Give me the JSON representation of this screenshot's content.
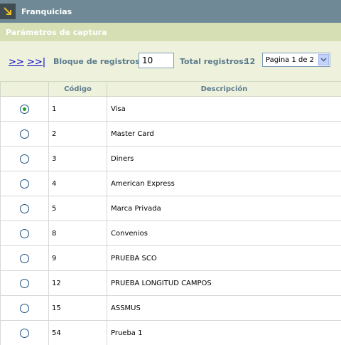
{
  "header": {
    "title": "Franquicias"
  },
  "section": {
    "title": "Parámetros de captura"
  },
  "controls": {
    "next_link": ">>",
    "last_link": ">>|",
    "block_label": "Bloque de registros:",
    "block_value": "10",
    "total_label": "Total registros:",
    "total_value": "12",
    "page_selected": "Pagina 1 de 2"
  },
  "table": {
    "columns": [
      "",
      "Código",
      "Descripción"
    ],
    "rows": [
      {
        "selected": true,
        "codigo": "1",
        "descripcion": "Visa"
      },
      {
        "selected": false,
        "codigo": "2",
        "descripcion": "Master Card"
      },
      {
        "selected": false,
        "codigo": "3",
        "descripcion": "Diners"
      },
      {
        "selected": false,
        "codigo": "4",
        "descripcion": "American Express"
      },
      {
        "selected": false,
        "codigo": "5",
        "descripcion": "Marca Privada"
      },
      {
        "selected": false,
        "codigo": "8",
        "descripcion": "Convenios"
      },
      {
        "selected": false,
        "codigo": "9",
        "descripcion": "PRUEBA SCO"
      },
      {
        "selected": false,
        "codigo": "12",
        "descripcion": "PRUEBA LONGITUD CAMPOS"
      },
      {
        "selected": false,
        "codigo": "15",
        "descripcion": "ASSMUS"
      },
      {
        "selected": false,
        "codigo": "54",
        "descripcion": "Prueba 1"
      }
    ]
  },
  "colors": {
    "titlebar": "#6f8a96",
    "section": "#d5dfb3",
    "controls_bg": "#eef2dc",
    "label": "#5a7a8c",
    "link": "#0000cc"
  }
}
